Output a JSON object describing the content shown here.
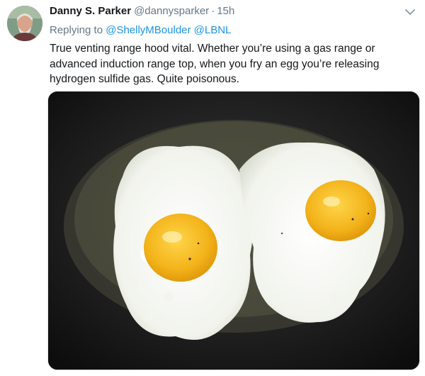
{
  "tweet": {
    "author_name": "Danny S. Parker",
    "author_handle": "@dannysparker",
    "separator": "·",
    "time": "15h",
    "replying_to_label": "Replying to",
    "mentions": [
      "@ShellyMBoulder",
      "@LBNL"
    ],
    "text": "True venting range hood vital. Whether you’re using a gas range or advanced induction range top, when you fry an egg you’re releasing hydrogen sulfide gas. Quite poisonous.",
    "menu_icon": "chevron-down-icon",
    "media_icon": "fried-eggs-photo"
  },
  "colors": {
    "text": "#14171a",
    "secondary": "#657786",
    "link": "#1b95e0"
  }
}
